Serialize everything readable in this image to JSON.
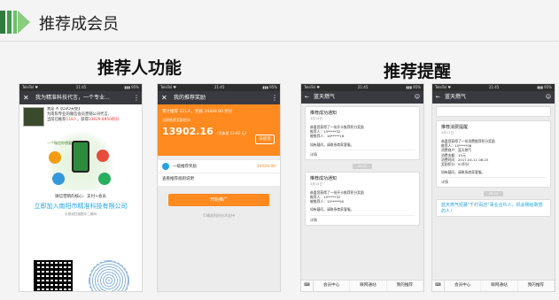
{
  "header": {
    "title": "推荐成会员"
  },
  "sections": {
    "left_title": "推荐人功能",
    "right_title": "推荐提醒"
  },
  "phone1": {
    "status_left": "TeleTel ♥",
    "status_time": "21:45",
    "status_right": "▮▮▮ 95%",
    "nav_title": "我为精准科技代言，一个专业...",
    "intro_line1": "我是 A【O2O天使】",
    "intro_line2": "为南阳专业的微信会员营销公司代言,",
    "intro_line3_pre": "当前已推荐",
    "intro_line3_count": "118人",
    "intro_line3_mid": "，获得",
    "intro_line3_points": "33629.8950积分",
    "graphic_label": "一个微信你想要的都能找到",
    "caption": "微信营销的核心：支付+会员",
    "join_text": "立即加入南阳市精准科技有限公司",
    "hint": "长按或扫描图中二维码"
  },
  "phone2": {
    "status_left": "TeleTel ♥",
    "status_time": "21:45",
    "status_right": "▮▮▮ 95%",
    "nav_title": "我的推荐奖励",
    "line1_pre": "累计推荐",
    "line1_count": "121",
    "line1_mid": "人，奖励",
    "line1_points": "34429.90",
    "line1_unit": "积分",
    "line2": "当前推荐奖励积分",
    "amount": "13902.16",
    "amount_sub": "(可体现 13.02 元)",
    "cash_button": "去提现",
    "row1_label": "一级推荐奖励",
    "row1_value": "34429.90",
    "row2_label": "查看推荐规则说明",
    "promo_button": "开始推广",
    "footer": "©精准科技技术支持"
  },
  "phone3": {
    "status_left": "TeleTel ♥",
    "status_time": "21:45",
    "status_right": "▮▮▮ 95%",
    "nav_title": "蓝天燃气",
    "cards": [
      {
        "title": "推荐成功通知",
        "date": "4月14日",
        "greeting": "恭喜您获得了一份开卡推荐积分奖励",
        "referrer": "推荐人：15*****32",
        "referee": "被推荐人：18*****18",
        "note": "如有疑问，请联系商家客服。",
        "detail": "详情"
      },
      {
        "title": "推荐成功通知",
        "date": "4月14日",
        "greeting": "恭喜您获得了一份开卡推荐积分奖励",
        "referrer": "推荐人：15*****32",
        "referee": "被推荐人：15*****90",
        "note": "如有疑问，请联系商家客服。",
        "detail": "详情"
      }
    ],
    "time_chip": "14:02",
    "tabs": [
      "会员中心",
      "联网通站",
      "我的推荐"
    ]
  },
  "phone4": {
    "status_left": "TeleTel ♥",
    "status_time": "21:45",
    "status_right": "▮▮▮ 95%",
    "nav_title": "蓝天燃气",
    "card": {
      "title": "推荐消费提醒",
      "date": "4月11日",
      "greeting": "恭喜您获得了一份消费推荐积分奖励",
      "referrer": "推荐人：15*****08",
      "merchant": "消费商户：蓝天燃气",
      "amount": "消费金额：15元",
      "time": "消费时间：2017-04-11 08:25",
      "points": "奖励积分：97积分",
      "note": "如有疑问，请联系商家客服。",
      "detail": "详情"
    },
    "big_card_title": "蓝天燃气招募\"千村百店\"事业合伙人，机会赐给敢想的人！",
    "time_chip": "08:25",
    "tabs": [
      "会员中心",
      "联网通站",
      "我的推荐"
    ]
  }
}
